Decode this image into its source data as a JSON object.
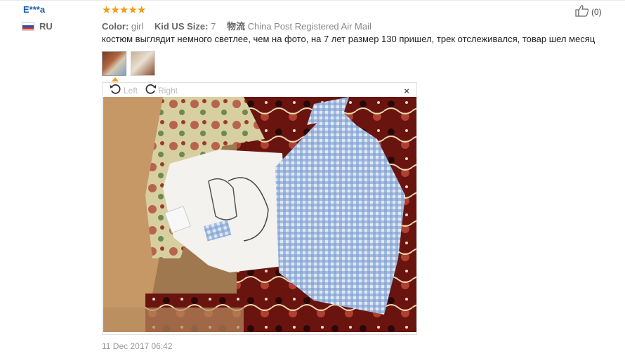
{
  "reviewer": {
    "name": "E***a",
    "country": "RU",
    "flag_colors": [
      "#ffffff",
      "#1f4fb4",
      "#d32f2f"
    ]
  },
  "rating": {
    "stars": 5,
    "star_char": "★",
    "accent": "#f39c12"
  },
  "helpful": {
    "count": "(0)",
    "icon": "thumbs-up-icon"
  },
  "attributes": {
    "color_label": "Color:",
    "color_value": "girl",
    "size_label": "Kid US Size:",
    "size_value": "7",
    "shipping_label": "物流",
    "shipping_value": "China Post Registered Air Mail"
  },
  "review_text": "костюм выглядит немного светлее, чем на фото, на 7 лет размер 130 пришел, трек отслеживался, товар шел месяц",
  "thumbnails": [
    {
      "name": "review-photo-1",
      "active": true
    },
    {
      "name": "review-photo-2",
      "active": false
    }
  ],
  "viewer": {
    "rotate_left_label": "Left",
    "rotate_right_label": "Right",
    "close_label": "×"
  },
  "date": "11 Dec 2017 06:42"
}
